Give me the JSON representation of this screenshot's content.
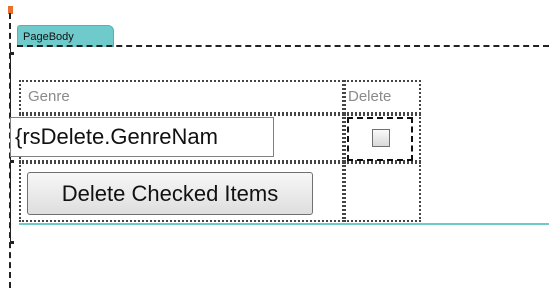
{
  "page_body": {
    "tab_label": "PageBody",
    "tab_color": "#6fcacb"
  },
  "grid": {
    "headers": {
      "genre": "Genre",
      "delete": "Delete"
    },
    "row": {
      "genre_field_value": "{rsDelete.GenreNam",
      "delete_checked": false
    },
    "action": {
      "delete_button_label": "Delete Checked Items"
    }
  },
  "colors": {
    "teal": "#6fcacb",
    "header_text": "#8a8a8a",
    "marker_orange": "#e7702a"
  }
}
